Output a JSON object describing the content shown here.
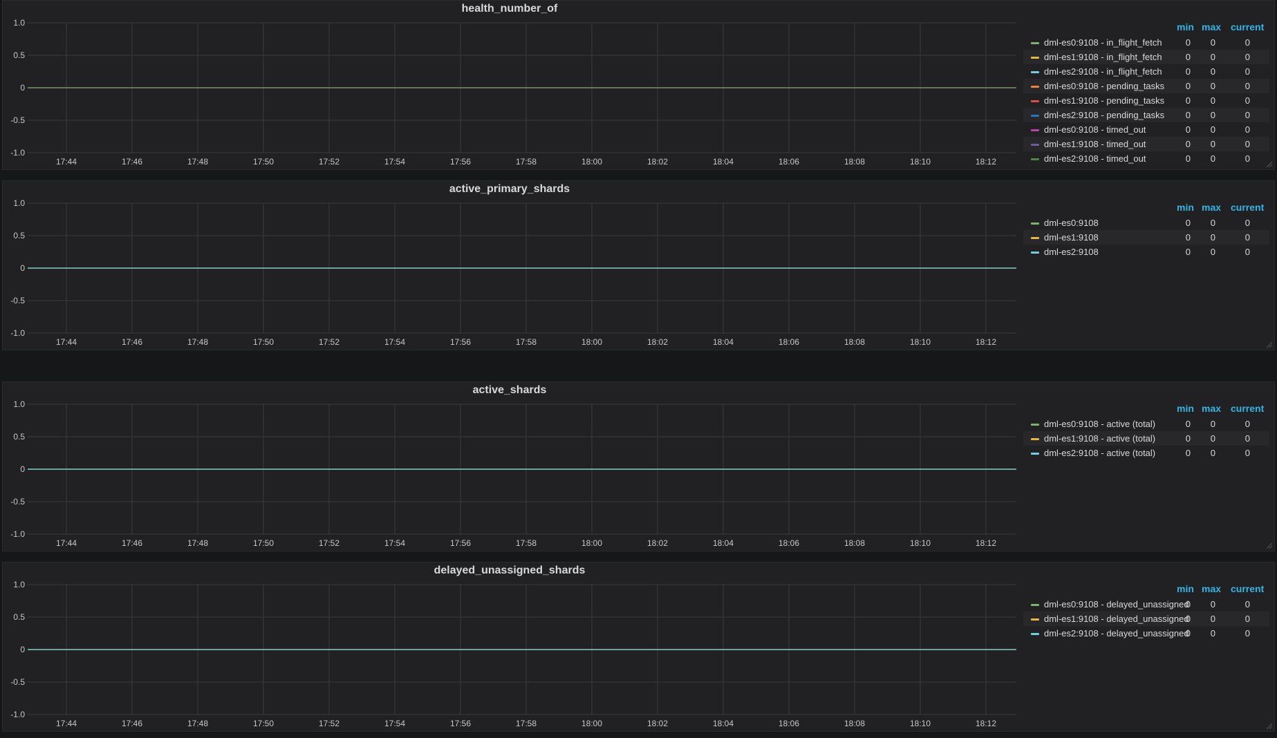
{
  "panels": [
    {
      "title": "health_number_of",
      "legend_headers": {
        "min": "min",
        "max": "max",
        "current": "current"
      },
      "series": [
        {
          "name": "dml-es0:9108 - in_flight_fetch",
          "color": "#7eb26d",
          "min": "0",
          "max": "0",
          "current": "0"
        },
        {
          "name": "dml-es1:9108 - in_flight_fetch",
          "color": "#eab839",
          "min": "0",
          "max": "0",
          "current": "0"
        },
        {
          "name": "dml-es2:9108 - in_flight_fetch",
          "color": "#6ed0e0",
          "min": "0",
          "max": "0",
          "current": "0"
        },
        {
          "name": "dml-es0:9108 - pending_tasks",
          "color": "#ef843c",
          "min": "0",
          "max": "0",
          "current": "0"
        },
        {
          "name": "dml-es1:9108 - pending_tasks",
          "color": "#e24d42",
          "min": "0",
          "max": "0",
          "current": "0"
        },
        {
          "name": "dml-es2:9108 - pending_tasks",
          "color": "#1f78c1",
          "min": "0",
          "max": "0",
          "current": "0"
        },
        {
          "name": "dml-es0:9108 - timed_out",
          "color": "#ba43a9",
          "min": "0",
          "max": "0",
          "current": "0"
        },
        {
          "name": "dml-es1:9108 - timed_out",
          "color": "#705da0",
          "min": "0",
          "max": "0",
          "current": "0"
        },
        {
          "name": "dml-es2:9108 - timed_out",
          "color": "#508642",
          "min": "0",
          "max": "0",
          "current": "0"
        }
      ]
    },
    {
      "title": "active_primary_shards",
      "legend_headers": {
        "min": "min",
        "max": "max",
        "current": "current"
      },
      "series": [
        {
          "name": "dml-es0:9108",
          "color": "#7eb26d",
          "min": "0",
          "max": "0",
          "current": "0"
        },
        {
          "name": "dml-es1:9108",
          "color": "#eab839",
          "min": "0",
          "max": "0",
          "current": "0"
        },
        {
          "name": "dml-es2:9108",
          "color": "#6ed0e0",
          "min": "0",
          "max": "0",
          "current": "0"
        }
      ]
    },
    {
      "title": "active_shards",
      "legend_headers": {
        "min": "min",
        "max": "max",
        "current": "current"
      },
      "series": [
        {
          "name": "dml-es0:9108 - active (total)",
          "color": "#7eb26d",
          "min": "0",
          "max": "0",
          "current": "0"
        },
        {
          "name": "dml-es1:9108 - active (total)",
          "color": "#eab839",
          "min": "0",
          "max": "0",
          "current": "0"
        },
        {
          "name": "dml-es2:9108 - active (total)",
          "color": "#6ed0e0",
          "min": "0",
          "max": "0",
          "current": "0"
        }
      ]
    },
    {
      "title": "delayed_unassigned_shards",
      "legend_headers": {
        "min": "min",
        "max": "max",
        "current": "current"
      },
      "series": [
        {
          "name": "dml-es0:9108 - delayed_unassigned",
          "color": "#7eb26d",
          "min": "0",
          "max": "0",
          "current": "0"
        },
        {
          "name": "dml-es1:9108 - delayed_unassigned",
          "color": "#eab839",
          "min": "0",
          "max": "0",
          "current": "0"
        },
        {
          "name": "dml-es2:9108 - delayed_unassigned",
          "color": "#6ed0e0",
          "min": "0",
          "max": "0",
          "current": "0"
        }
      ]
    }
  ],
  "chart_data": [
    {
      "type": "line",
      "title": "health_number_of",
      "x": [
        "17:44",
        "17:46",
        "17:48",
        "17:50",
        "17:52",
        "17:54",
        "17:56",
        "17:58",
        "18:00",
        "18:02",
        "18:04",
        "18:06",
        "18:08",
        "18:10",
        "18:12"
      ],
      "x_tick_labels": [
        "17:44",
        "17:46",
        "17:48",
        "17:50",
        "17:52",
        "17:54",
        "17:56",
        "17:58",
        "18:00",
        "18:02",
        "18:04",
        "18:06",
        "18:08",
        "18:10",
        "18:12"
      ],
      "y_tick_labels": [
        "1.0",
        "0.5",
        "0",
        "-0.5",
        "-1.0"
      ],
      "ylim": [
        -1.0,
        1.0
      ],
      "grid": true,
      "legend_placement": "right",
      "series": [
        {
          "name": "dml-es0:9108 - in_flight_fetch",
          "values": [
            0,
            0,
            0,
            0,
            0,
            0,
            0,
            0,
            0,
            0,
            0,
            0,
            0,
            0,
            0
          ]
        },
        {
          "name": "dml-es1:9108 - in_flight_fetch",
          "values": [
            0,
            0,
            0,
            0,
            0,
            0,
            0,
            0,
            0,
            0,
            0,
            0,
            0,
            0,
            0
          ]
        },
        {
          "name": "dml-es2:9108 - in_flight_fetch",
          "values": [
            0,
            0,
            0,
            0,
            0,
            0,
            0,
            0,
            0,
            0,
            0,
            0,
            0,
            0,
            0
          ]
        },
        {
          "name": "dml-es0:9108 - pending_tasks",
          "values": [
            0,
            0,
            0,
            0,
            0,
            0,
            0,
            0,
            0,
            0,
            0,
            0,
            0,
            0,
            0
          ]
        },
        {
          "name": "dml-es1:9108 - pending_tasks",
          "values": [
            0,
            0,
            0,
            0,
            0,
            0,
            0,
            0,
            0,
            0,
            0,
            0,
            0,
            0,
            0
          ]
        },
        {
          "name": "dml-es2:9108 - pending_tasks",
          "values": [
            0,
            0,
            0,
            0,
            0,
            0,
            0,
            0,
            0,
            0,
            0,
            0,
            0,
            0,
            0
          ]
        },
        {
          "name": "dml-es0:9108 - timed_out",
          "values": [
            0,
            0,
            0,
            0,
            0,
            0,
            0,
            0,
            0,
            0,
            0,
            0,
            0,
            0,
            0
          ]
        },
        {
          "name": "dml-es1:9108 - timed_out",
          "values": [
            0,
            0,
            0,
            0,
            0,
            0,
            0,
            0,
            0,
            0,
            0,
            0,
            0,
            0,
            0
          ]
        },
        {
          "name": "dml-es2:9108 - timed_out",
          "values": [
            0,
            0,
            0,
            0,
            0,
            0,
            0,
            0,
            0,
            0,
            0,
            0,
            0,
            0,
            0
          ]
        }
      ]
    },
    {
      "type": "line",
      "title": "active_primary_shards",
      "x": [
        "17:44",
        "17:46",
        "17:48",
        "17:50",
        "17:52",
        "17:54",
        "17:56",
        "17:58",
        "18:00",
        "18:02",
        "18:04",
        "18:06",
        "18:08",
        "18:10",
        "18:12"
      ],
      "x_tick_labels": [
        "17:44",
        "17:46",
        "17:48",
        "17:50",
        "17:52",
        "17:54",
        "17:56",
        "17:58",
        "18:00",
        "18:02",
        "18:04",
        "18:06",
        "18:08",
        "18:10",
        "18:12"
      ],
      "y_tick_labels": [
        "1.0",
        "0.5",
        "0",
        "-0.5",
        "-1.0"
      ],
      "ylim": [
        -1.0,
        1.0
      ],
      "grid": true,
      "legend_placement": "right",
      "series": [
        {
          "name": "dml-es0:9108",
          "values": [
            0,
            0,
            0,
            0,
            0,
            0,
            0,
            0,
            0,
            0,
            0,
            0,
            0,
            0,
            0
          ]
        },
        {
          "name": "dml-es1:9108",
          "values": [
            0,
            0,
            0,
            0,
            0,
            0,
            0,
            0,
            0,
            0,
            0,
            0,
            0,
            0,
            0
          ]
        },
        {
          "name": "dml-es2:9108",
          "values": [
            0,
            0,
            0,
            0,
            0,
            0,
            0,
            0,
            0,
            0,
            0,
            0,
            0,
            0,
            0
          ]
        }
      ]
    },
    {
      "type": "line",
      "title": "active_shards",
      "x": [
        "17:44",
        "17:46",
        "17:48",
        "17:50",
        "17:52",
        "17:54",
        "17:56",
        "17:58",
        "18:00",
        "18:02",
        "18:04",
        "18:06",
        "18:08",
        "18:10",
        "18:12"
      ],
      "x_tick_labels": [
        "17:44",
        "17:46",
        "17:48",
        "17:50",
        "17:52",
        "17:54",
        "17:56",
        "17:58",
        "18:00",
        "18:02",
        "18:04",
        "18:06",
        "18:08",
        "18:10",
        "18:12"
      ],
      "y_tick_labels": [
        "1.0",
        "0.5",
        "0",
        "-0.5",
        "-1.0"
      ],
      "ylim": [
        -1.0,
        1.0
      ],
      "grid": true,
      "legend_placement": "right",
      "series": [
        {
          "name": "dml-es0:9108 - active (total)",
          "values": [
            0,
            0,
            0,
            0,
            0,
            0,
            0,
            0,
            0,
            0,
            0,
            0,
            0,
            0,
            0
          ]
        },
        {
          "name": "dml-es1:9108 - active (total)",
          "values": [
            0,
            0,
            0,
            0,
            0,
            0,
            0,
            0,
            0,
            0,
            0,
            0,
            0,
            0,
            0
          ]
        },
        {
          "name": "dml-es2:9108 - active (total)",
          "values": [
            0,
            0,
            0,
            0,
            0,
            0,
            0,
            0,
            0,
            0,
            0,
            0,
            0,
            0,
            0
          ]
        }
      ]
    },
    {
      "type": "line",
      "title": "delayed_unassigned_shards",
      "x": [
        "17:44",
        "17:46",
        "17:48",
        "17:50",
        "17:52",
        "17:54",
        "17:56",
        "17:58",
        "18:00",
        "18:02",
        "18:04",
        "18:06",
        "18:08",
        "18:10",
        "18:12"
      ],
      "x_tick_labels": [
        "17:44",
        "17:46",
        "17:48",
        "17:50",
        "17:52",
        "17:54",
        "17:56",
        "17:58",
        "18:00",
        "18:02",
        "18:04",
        "18:06",
        "18:08",
        "18:10",
        "18:12"
      ],
      "y_tick_labels": [
        "1.0",
        "0.5",
        "0",
        "-0.5",
        "-1.0"
      ],
      "ylim": [
        -1.0,
        1.0
      ],
      "grid": true,
      "legend_placement": "right",
      "series": [
        {
          "name": "dml-es0:9108 - delayed_unassigned",
          "values": [
            0,
            0,
            0,
            0,
            0,
            0,
            0,
            0,
            0,
            0,
            0,
            0,
            0,
            0,
            0
          ]
        },
        {
          "name": "dml-es1:9108 - delayed_unassigned",
          "values": [
            0,
            0,
            0,
            0,
            0,
            0,
            0,
            0,
            0,
            0,
            0,
            0,
            0,
            0,
            0
          ]
        },
        {
          "name": "dml-es2:9108 - delayed_unassigned",
          "values": [
            0,
            0,
            0,
            0,
            0,
            0,
            0,
            0,
            0,
            0,
            0,
            0,
            0,
            0,
            0
          ]
        }
      ]
    }
  ]
}
